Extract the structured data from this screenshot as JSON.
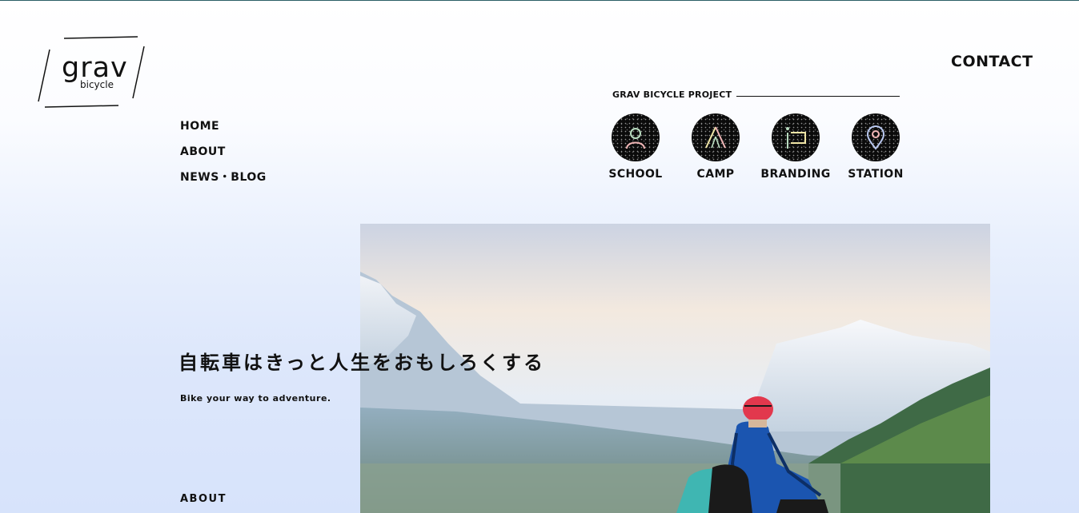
{
  "logo": {
    "main": "grav",
    "sub": "bicycle"
  },
  "header": {
    "contact": "CONTACT"
  },
  "nav": [
    {
      "label": "HOME"
    },
    {
      "label": "ABOUT"
    },
    {
      "label": "NEWS・BLOG"
    }
  ],
  "projects": {
    "title": "GRAV BICYCLE PROJECT",
    "items": [
      {
        "label": "SCHOOL",
        "icon": "person-icon"
      },
      {
        "label": "CAMP",
        "icon": "tent-icon"
      },
      {
        "label": "BRANDING",
        "icon": "flag-icon"
      },
      {
        "label": "STATION",
        "icon": "location-pin-icon"
      }
    ]
  },
  "hero": {
    "heading": "自転車はきっと人生をおもしろくする",
    "subheading": "Bike your way to adventure.",
    "section_link": "ABOUT",
    "image": "cyclist-overlooking-mountain-valley"
  },
  "colors": {
    "text": "#111111",
    "top_line": "#2b5f66",
    "background_bottom": "#d7e3fb",
    "helmet": "#e2384d",
    "jacket": "#1b55b0",
    "bag": "#3fb6b2"
  }
}
